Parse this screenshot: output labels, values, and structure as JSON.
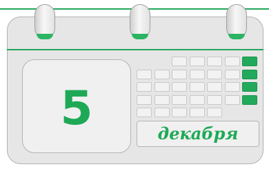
{
  "calendar": {
    "day": "5",
    "month": "декабря"
  },
  "colors": {
    "accent": "#21a55a",
    "body": "#e6e6e6",
    "card": "#f0f0f0",
    "outline": "#b0b0b0"
  },
  "icons": {
    "ring": "binder-ring-icon"
  }
}
